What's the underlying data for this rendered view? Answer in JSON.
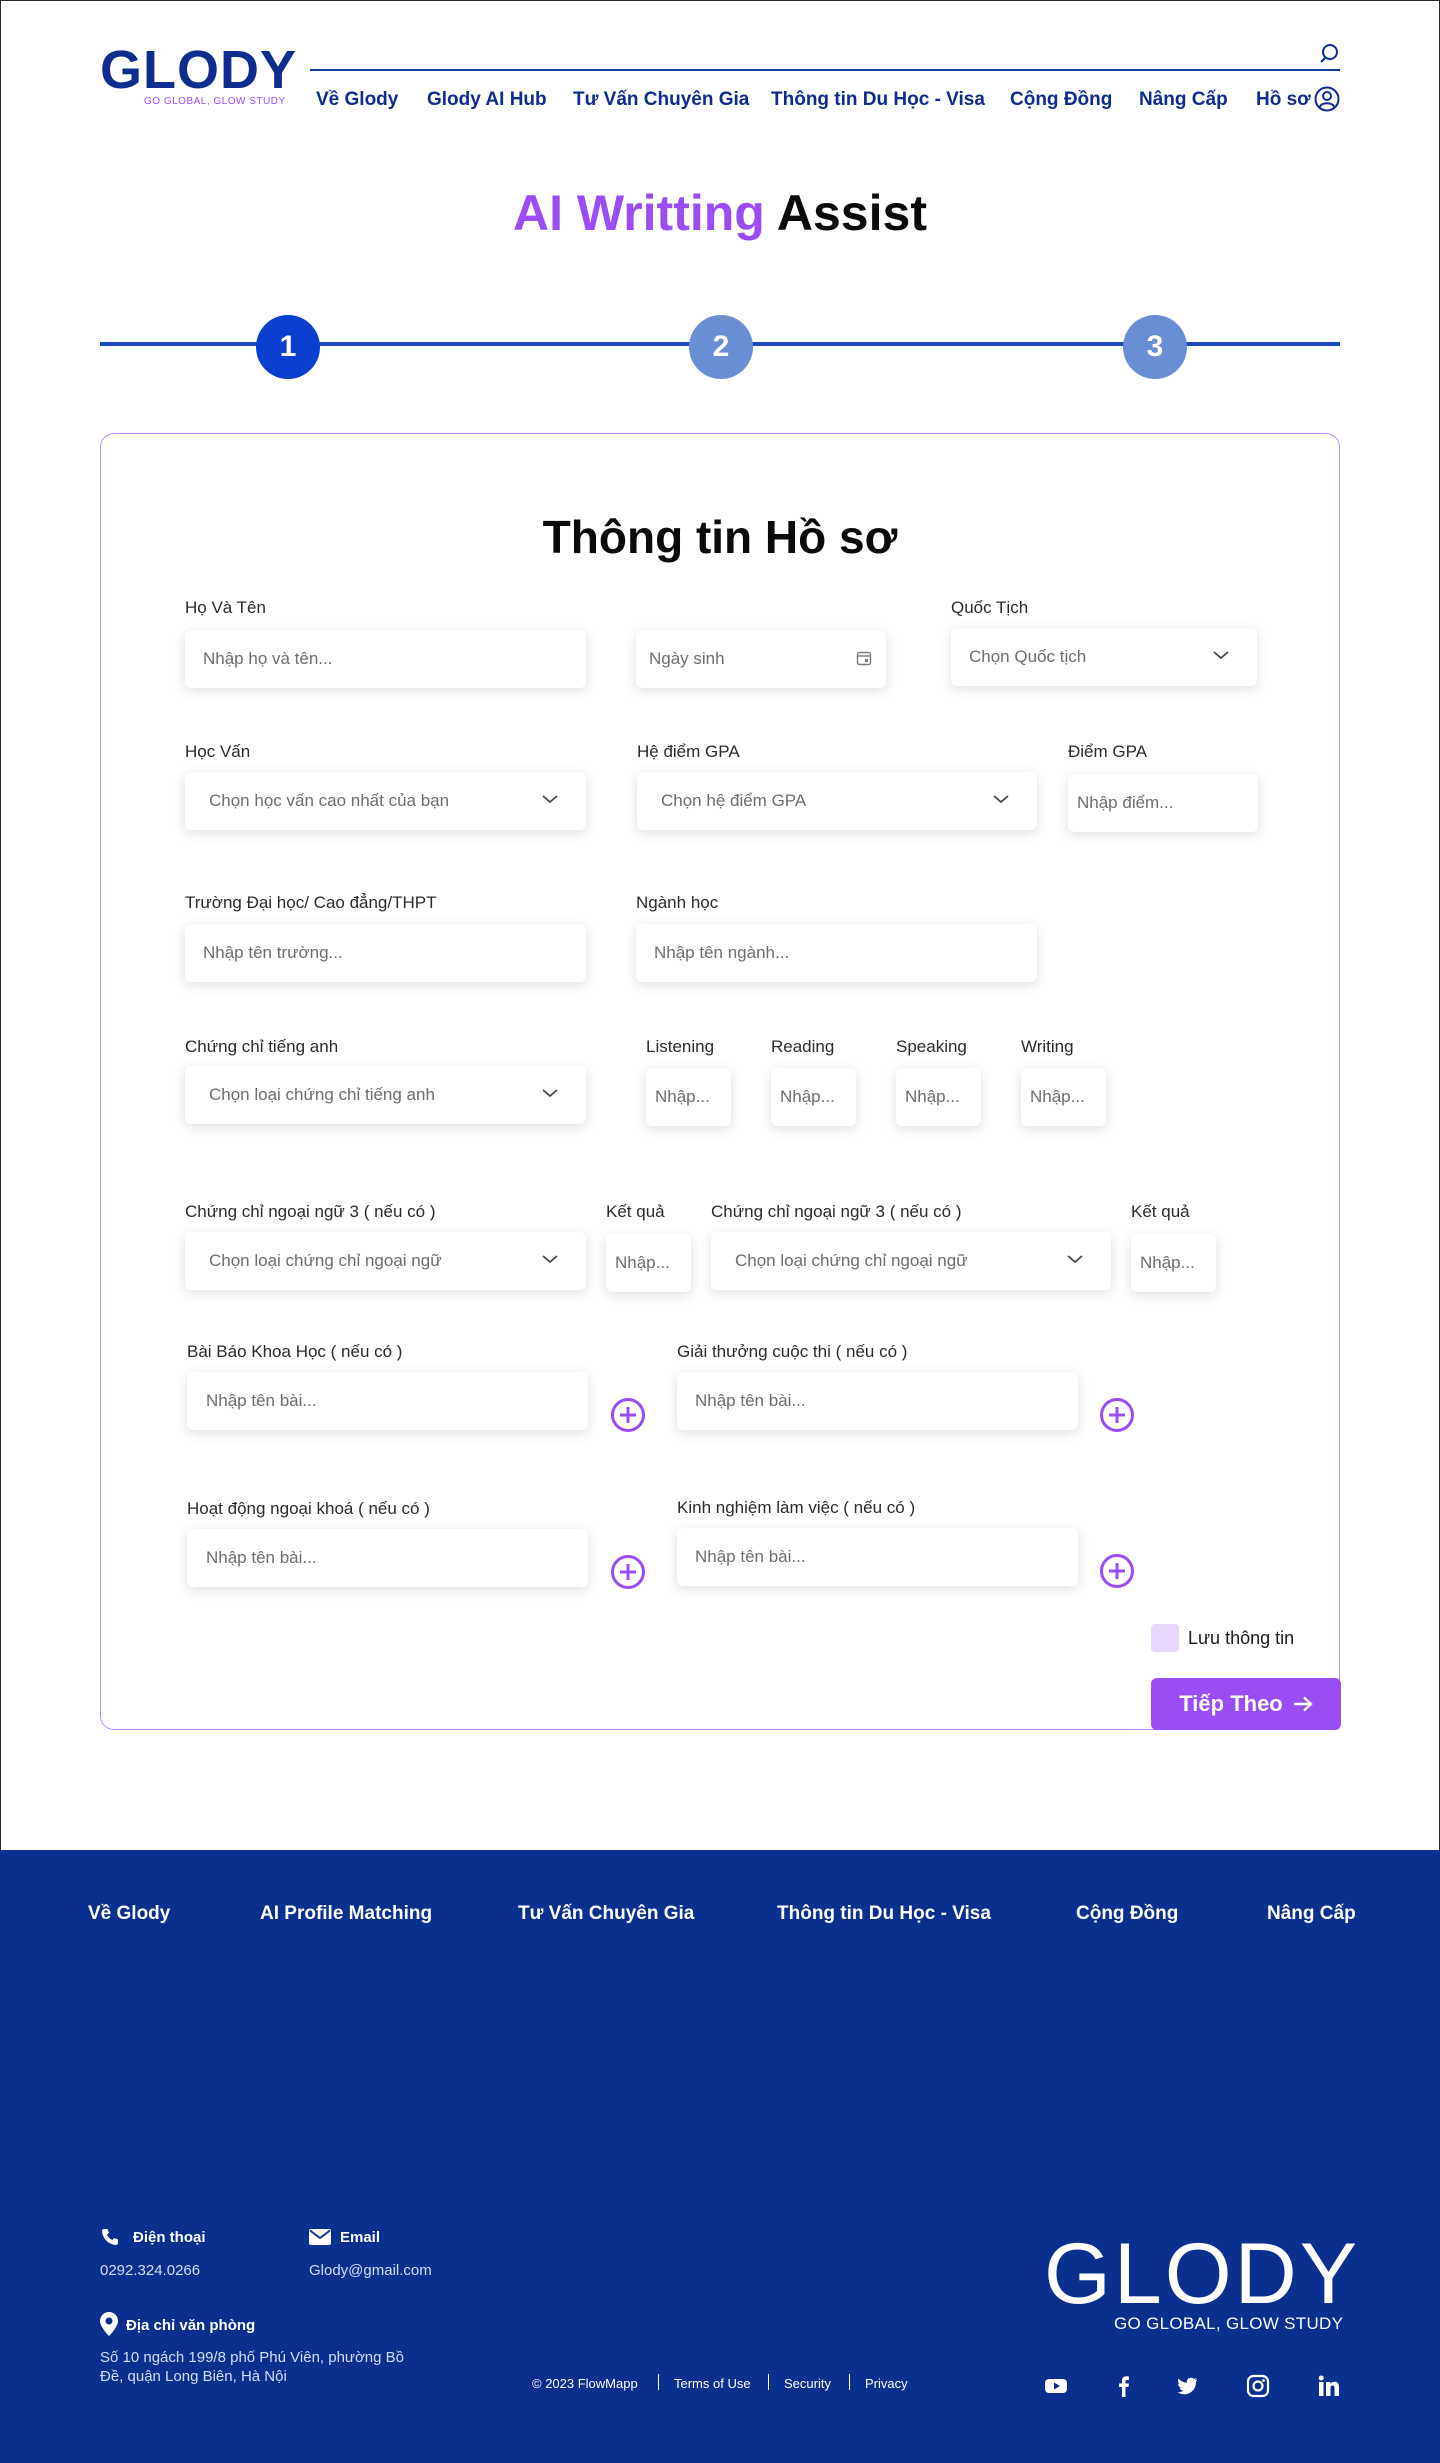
{
  "header": {
    "logo_word": "GLODY",
    "logo_tagline": "GO GLOBAL, GLOW STUDY",
    "nav": [
      "Về Glody",
      "Glody AI Hub",
      "Tư Vấn Chuyên Gia",
      "Thông tin Du Học - Visa",
      "Cộng Đồng",
      "Nâng Cấp",
      "Hồ sơ"
    ]
  },
  "page_title": {
    "accent": "AI Writting",
    "rest": "Assist"
  },
  "stepper": {
    "steps": [
      "1",
      "2",
      "3"
    ],
    "active": 1
  },
  "form": {
    "title": "Thông tin Hồ sơ",
    "full_name": {
      "label": "Họ Và Tên",
      "placeholder": "Nhập họ và tên..."
    },
    "birthday": {
      "placeholder": "Ngày sinh"
    },
    "nationality": {
      "label": "Quốc Tịch",
      "placeholder": "Chọn Quốc tịch"
    },
    "education": {
      "label": "Học Vấn",
      "placeholder": "Chọn học vấn cao nhất của bạn"
    },
    "gpa_scale": {
      "label": "Hệ điểm GPA",
      "placeholder": "Chọn hệ điểm GPA"
    },
    "gpa": {
      "label": "Điểm GPA",
      "placeholder": "Nhập điểm..."
    },
    "school": {
      "label": "Trường Đại học/ Cao đẳng/THPT",
      "placeholder": "Nhập tên trường..."
    },
    "major": {
      "label": "Ngành học",
      "placeholder": "Nhập tên ngành..."
    },
    "english_cert": {
      "label": "Chứng chỉ tiếng anh",
      "placeholder": "Chọn loại chứng chỉ tiếng anh"
    },
    "skills": [
      {
        "label": "Listening",
        "placeholder": "Nhập..."
      },
      {
        "label": "Reading",
        "placeholder": "Nhập..."
      },
      {
        "label": "Speaking",
        "placeholder": "Nhập..."
      },
      {
        "label": "Writing",
        "placeholder": "Nhập..."
      }
    ],
    "lang_cert_1": {
      "label": "Chứng chỉ ngoại ngữ 3 ( nếu có )",
      "placeholder": "Chọn loại chứng chỉ ngoại ngữ"
    },
    "lang_result_1": {
      "label": "Kết quả",
      "placeholder": "Nhập..."
    },
    "lang_cert_2": {
      "label": "Chứng chỉ ngoại ngữ 3 ( nếu có )",
      "placeholder": "Chọn loại chứng chỉ ngoại ngữ"
    },
    "lang_result_2": {
      "label": "Kết quả",
      "placeholder": "Nhập..."
    },
    "paper": {
      "label": "Bài Báo Khoa Học ( nếu có )",
      "placeholder": "Nhập tên bài..."
    },
    "award": {
      "label": "Giải thưởng cuộc thi ( nếu có )",
      "placeholder": "Nhập tên bài..."
    },
    "activity": {
      "label": "Hoạt động ngoại khoá ( nếu có )",
      "placeholder": "Nhập tên bài..."
    },
    "experience": {
      "label": "Kinh nghiệm làm việc ( nếu có )",
      "placeholder": "Nhập tên bài..."
    },
    "save_label": "Lưu thông tin",
    "next_label": "Tiếp Theo"
  },
  "footer": {
    "nav": [
      "Về Glody",
      "AI Profile Matching",
      "Tư Vấn Chuyên Gia",
      "Thông tin Du Học - Visa",
      "Cộng Đồng",
      "Nâng Cấp"
    ],
    "phone_title": "Điện thoại",
    "phone": "0292.324.0266",
    "email_title": "Email",
    "email": "Glody@gmail.com",
    "address_title": "Địa chỉ văn phòng",
    "address": "Số 10 ngách 199/8 phố Phú Viên, phường Bồ Đề, quận Long Biên, Hà Nội",
    "copyright": "© 2023 FlowMapp",
    "links": [
      "Terms of Use",
      "Security",
      "Privacy"
    ],
    "logo_word": "GLODY",
    "logo_tagline": "GO GLOBAL, GLOW STUDY",
    "social": [
      "youtube-icon",
      "facebook-icon",
      "twitter-icon",
      "instagram-icon",
      "linkedin-icon"
    ]
  },
  "colors": {
    "brand_blue": "#0f2d8f",
    "accent_purple": "#9a4cf5",
    "footer_bg": "#0b2f8e",
    "step_active": "#0b3fcf",
    "step_inactive": "#6a8ed4"
  }
}
